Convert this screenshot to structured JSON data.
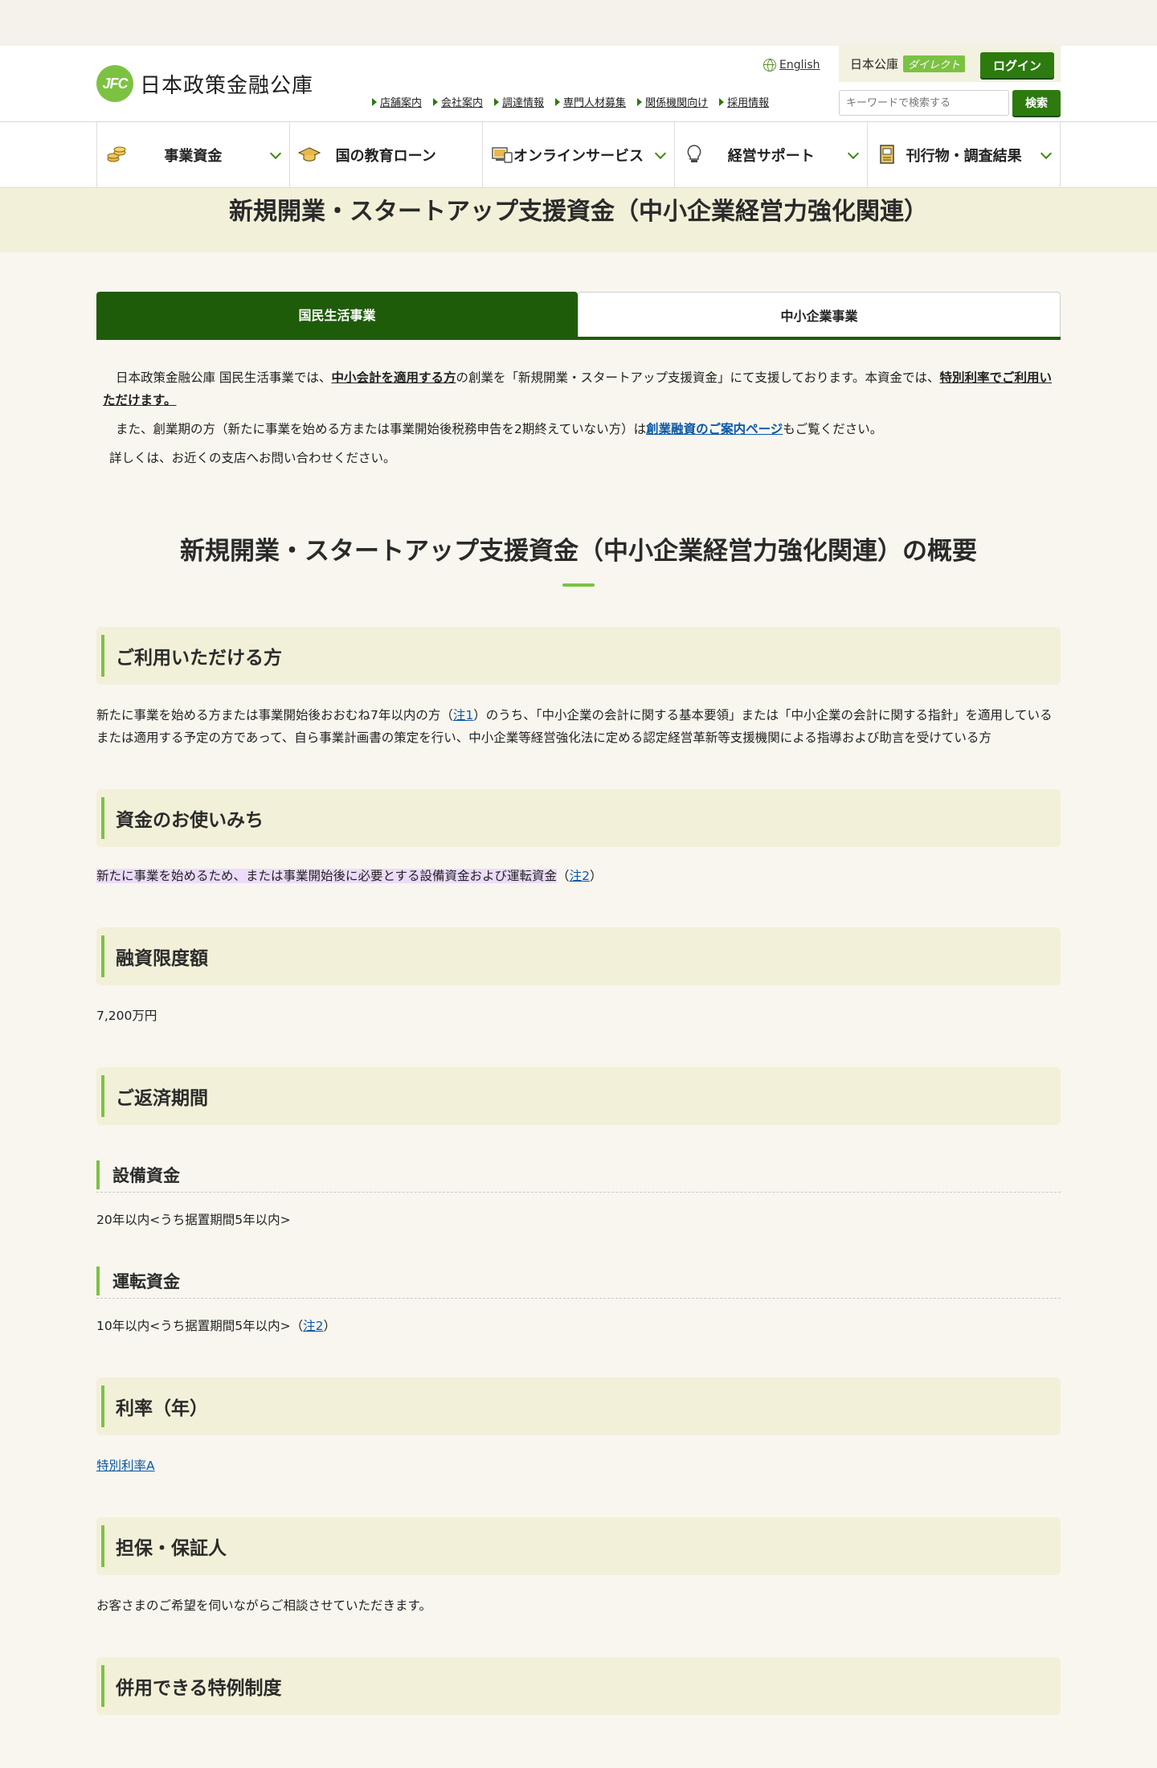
{
  "header": {
    "logo_mark": "JFC",
    "logo_text": "日本政策金融公庫",
    "english_label": "English",
    "direct_label": "日本公庫",
    "direct_tag": "ダイレクト",
    "login_label": "ログイン",
    "util_links": [
      "店舗案内",
      "会社案内",
      "調達情報",
      "専門人材募集",
      "関係機関向け",
      "採用情報"
    ],
    "search_placeholder": "キーワードで検索する",
    "search_label": "検索"
  },
  "nav": {
    "items": [
      {
        "label": "事業資金",
        "icon": "coins-icon",
        "has_chevron": true
      },
      {
        "label": "国の教育ローン",
        "icon": "graduation-cap-icon",
        "has_chevron": false
      },
      {
        "label": "オンラインサービス",
        "icon": "computer-icon",
        "has_chevron": true
      },
      {
        "label": "経営サポート",
        "icon": "lightbulb-icon",
        "has_chevron": true
      },
      {
        "label": "刊行物・調査結果",
        "icon": "document-icon",
        "has_chevron": true
      }
    ]
  },
  "page_title": "新規開業・スタートアップ支援資金（中小企業経営力強化関連）",
  "tabs": [
    {
      "label": "国民生活事業",
      "active": true
    },
    {
      "label": "中小企業事業",
      "active": false
    }
  ],
  "intro": {
    "p1_a": "日本政策金融公庫 国民生活事業では、",
    "p1_u1": "中小会計を適用する方",
    "p1_b": "の創業を「新規開業・スタートアップ支援資金」にて支援しております。本資金では、",
    "p1_u2": "特別利率でご利用いただけます。",
    "p2_a": "また、創業期の方（新たに事業を始める方または事業開始後税務申告を2期終えていない方）は",
    "p2_link": "創業融資のご案内ページ",
    "p2_b": "もご覧ください。",
    "p3": "詳しくは、お近くの支店へお問い合わせください。"
  },
  "overview_title": "新規開業・スタートアップ支援資金（中小企業経営力強化関連）の概要",
  "sections": {
    "eligible": {
      "heading": "ご利用いただける方",
      "text_a": "新たに事業を始める方または事業開始後おおむね7年以内の方（",
      "note1": "注1",
      "text_b": "）のうち、「中小企業の会計に関する基本要領」または「中小企業の会計に関する指針」を適用しているまたは適用する予定の方であって、自ら事業計画書の策定を行い、中小企業等経営強化法に定める認定経営革新等支援機関による指導および助言を受けている方"
    },
    "usage": {
      "heading": "資金のお使いみち",
      "text": "新たに事業を始めるため、または事業開始後に必要とする設備資金および運転資金",
      "paren_open": "（",
      "note2": "注2",
      "paren_close": "）"
    },
    "limit": {
      "heading": "融資限度額",
      "text": "7,200万円"
    },
    "repayment": {
      "heading": "ご返済期間",
      "equipment_heading": "設備資金",
      "equipment_text": "20年以内<うち据置期間5年以内>",
      "working_heading": "運転資金",
      "working_text": "10年以内<うち据置期間5年以内>",
      "paren_open": "（",
      "note2": "注2",
      "paren_close": "）"
    },
    "rate": {
      "heading": "利率（年）",
      "link": "特別利率A"
    },
    "collateral": {
      "heading": "担保・保証人",
      "text": "お客さまのご希望を伺いながらご相談させていただきます。"
    },
    "special": {
      "heading": "併用できる特例制度"
    }
  },
  "colors": {
    "brand_green": "#2d7a0e",
    "accent_lime": "#7cc242",
    "section_bg": "#f3f0d9",
    "link_blue": "#0b58a6",
    "tab_active": "#1f5c0a"
  }
}
